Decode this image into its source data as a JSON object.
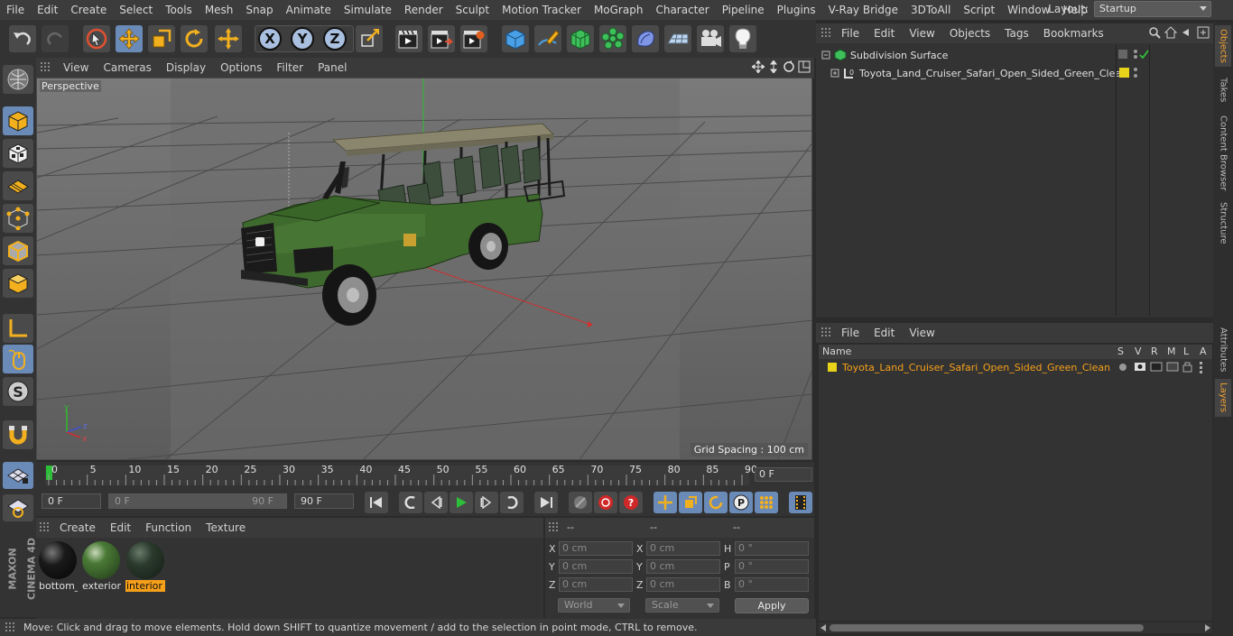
{
  "menubar": {
    "items": [
      "File",
      "Edit",
      "Create",
      "Select",
      "Tools",
      "Mesh",
      "Snap",
      "Animate",
      "Simulate",
      "Render",
      "Sculpt",
      "Motion Tracker",
      "MoGraph",
      "Character",
      "Pipeline",
      "Plugins",
      "V-Ray Bridge",
      "3DToAll",
      "Script",
      "Window",
      "Help"
    ],
    "layout_label": "Layout:",
    "layout_value": "Startup"
  },
  "toolbar": {
    "axis_x": "X",
    "axis_y": "Y",
    "axis_z": "Z"
  },
  "viewport": {
    "menu": [
      "View",
      "Cameras",
      "Display",
      "Options",
      "Filter",
      "Panel"
    ],
    "camera_label": "Perspective",
    "grid_spacing": "Grid Spacing : 100 cm",
    "axis_x": "x",
    "axis_y": "y",
    "axis_z": "z"
  },
  "timeline": {
    "ticks": [
      "0",
      "5",
      "10",
      "15",
      "20",
      "25",
      "30",
      "35",
      "40",
      "45",
      "50",
      "55",
      "60",
      "65",
      "70",
      "75",
      "80",
      "85",
      "90"
    ],
    "current_frame": "0 F"
  },
  "transport": {
    "start_frame": "0 F",
    "range_start": "0 F",
    "range_end": "90 F",
    "end_frame": "90 F"
  },
  "material_manager": {
    "menu": [
      "Create",
      "Edit",
      "Function",
      "Texture"
    ],
    "materials": [
      {
        "name": "bottom_",
        "color": "#151515"
      },
      {
        "name": "exterior",
        "color": "#3e6a2e"
      },
      {
        "name": "interior",
        "color": "#243426"
      }
    ]
  },
  "coordinates": {
    "head": [
      "--",
      "--",
      "--"
    ],
    "pos_labels": [
      "X",
      "Y",
      "Z"
    ],
    "pos_values": [
      "0 cm",
      "0 cm",
      "0 cm"
    ],
    "size_labels": [
      "X",
      "Y",
      "Z"
    ],
    "size_values": [
      "0 cm",
      "0 cm",
      "0 cm"
    ],
    "rot_labels": [
      "H",
      "P",
      "B"
    ],
    "rot_values": [
      "0 °",
      "0 °",
      "0 °"
    ],
    "mode": "World",
    "size_mode": "Scale",
    "apply": "Apply"
  },
  "status": "Move: Click and drag to move elements. Hold down SHIFT to quantize movement / add to the selection in point mode, CTRL to remove.",
  "object_manager": {
    "menu": [
      "File",
      "Edit",
      "View",
      "Objects",
      "Tags",
      "Bookmarks"
    ],
    "objects": [
      {
        "name": "Subdivision Surface"
      },
      {
        "name": "Toyota_Land_Cruiser_Safari_Open_Sided_Green_Clean"
      }
    ]
  },
  "layer_manager": {
    "menu": [
      "File",
      "Edit",
      "View"
    ],
    "columns": [
      "Name",
      "S",
      "V",
      "R",
      "M",
      "L",
      "A"
    ],
    "layers": [
      {
        "name": "Toyota_Land_Cruiser_Safari_Open_Sided_Green_Clean",
        "color": "#e8d21a"
      }
    ]
  },
  "right_tabs": {
    "top": [
      "Objects",
      "Takes",
      "Content Browser",
      "Structure"
    ],
    "bottom": [
      "Attributes",
      "Layers"
    ]
  },
  "brand": {
    "line1": "MAXON",
    "line2": "CINEMA 4D"
  },
  "colors": {
    "accent_orange": "#f6a01a",
    "active_blue": "#6a8ab8",
    "layer_yellow": "#e8d21a",
    "vehicle_green": "#3e6a2e"
  }
}
